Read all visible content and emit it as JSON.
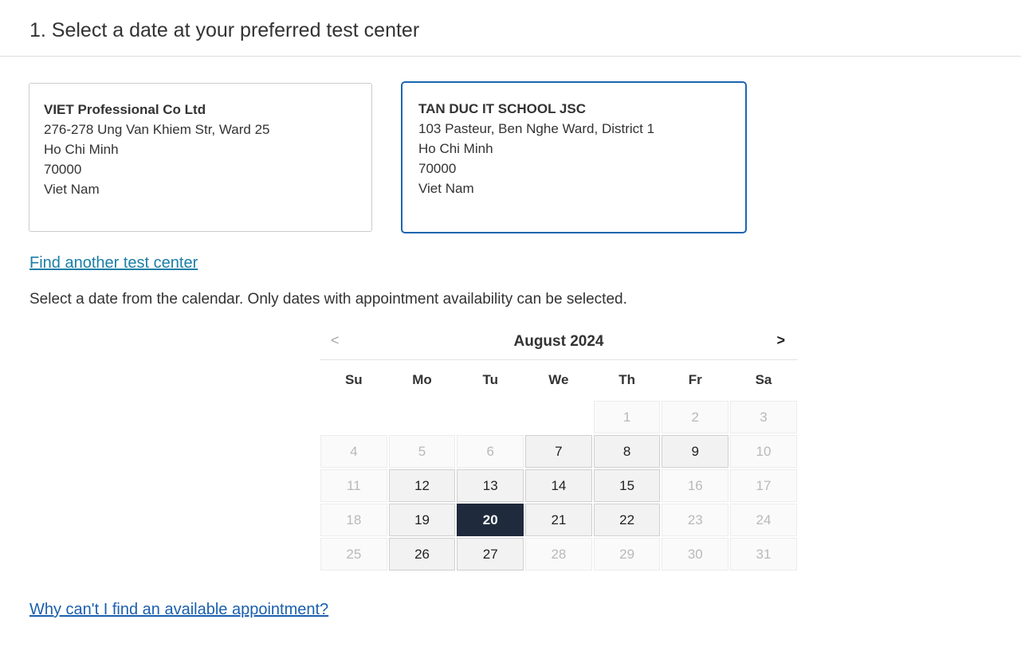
{
  "header": {
    "title": "1. Select a date at your preferred test center"
  },
  "test_centers": [
    {
      "name": "VIET Professional Co Ltd",
      "address": "276-278 Ung Van Khiem Str, Ward 25",
      "city": "Ho Chi Minh",
      "postal_code": "70000",
      "country": "Viet Nam",
      "selected": false
    },
    {
      "name": "TAN DUC IT SCHOOL JSC",
      "address": "103 Pasteur, Ben Nghe Ward, District 1",
      "city": "Ho Chi Minh",
      "postal_code": "70000",
      "country": "Viet Nam",
      "selected": true
    }
  ],
  "links": {
    "find_another": "Find another test center",
    "why_unavailable": "Why can't I find an available appointment?"
  },
  "instructions": "Select a date from the calendar. Only dates with appointment availability can be selected.",
  "calendar": {
    "prev_label": "<",
    "next_label": ">",
    "month_label": "August 2024",
    "weekdays": [
      "Su",
      "Mo",
      "Tu",
      "We",
      "Th",
      "Fr",
      "Sa"
    ],
    "leading_blanks": 4,
    "days": [
      {
        "day": "1",
        "state": "disabled"
      },
      {
        "day": "2",
        "state": "disabled"
      },
      {
        "day": "3",
        "state": "disabled"
      },
      {
        "day": "4",
        "state": "disabled"
      },
      {
        "day": "5",
        "state": "disabled"
      },
      {
        "day": "6",
        "state": "disabled"
      },
      {
        "day": "7",
        "state": "available"
      },
      {
        "day": "8",
        "state": "available"
      },
      {
        "day": "9",
        "state": "available"
      },
      {
        "day": "10",
        "state": "disabled"
      },
      {
        "day": "11",
        "state": "disabled"
      },
      {
        "day": "12",
        "state": "available"
      },
      {
        "day": "13",
        "state": "available"
      },
      {
        "day": "14",
        "state": "available"
      },
      {
        "day": "15",
        "state": "available"
      },
      {
        "day": "16",
        "state": "disabled"
      },
      {
        "day": "17",
        "state": "disabled"
      },
      {
        "day": "18",
        "state": "disabled"
      },
      {
        "day": "19",
        "state": "available"
      },
      {
        "day": "20",
        "state": "selected"
      },
      {
        "day": "21",
        "state": "available"
      },
      {
        "day": "22",
        "state": "available"
      },
      {
        "day": "23",
        "state": "disabled"
      },
      {
        "day": "24",
        "state": "disabled"
      },
      {
        "day": "25",
        "state": "disabled"
      },
      {
        "day": "26",
        "state": "available"
      },
      {
        "day": "27",
        "state": "available"
      },
      {
        "day": "28",
        "state": "disabled"
      },
      {
        "day": "29",
        "state": "disabled"
      },
      {
        "day": "30",
        "state": "disabled"
      },
      {
        "day": "31",
        "state": "disabled"
      }
    ]
  },
  "colors": {
    "selected_card_border": "#1a66b0",
    "selected_day_bg": "#1f2b3d",
    "link": "#1c7ea6"
  }
}
